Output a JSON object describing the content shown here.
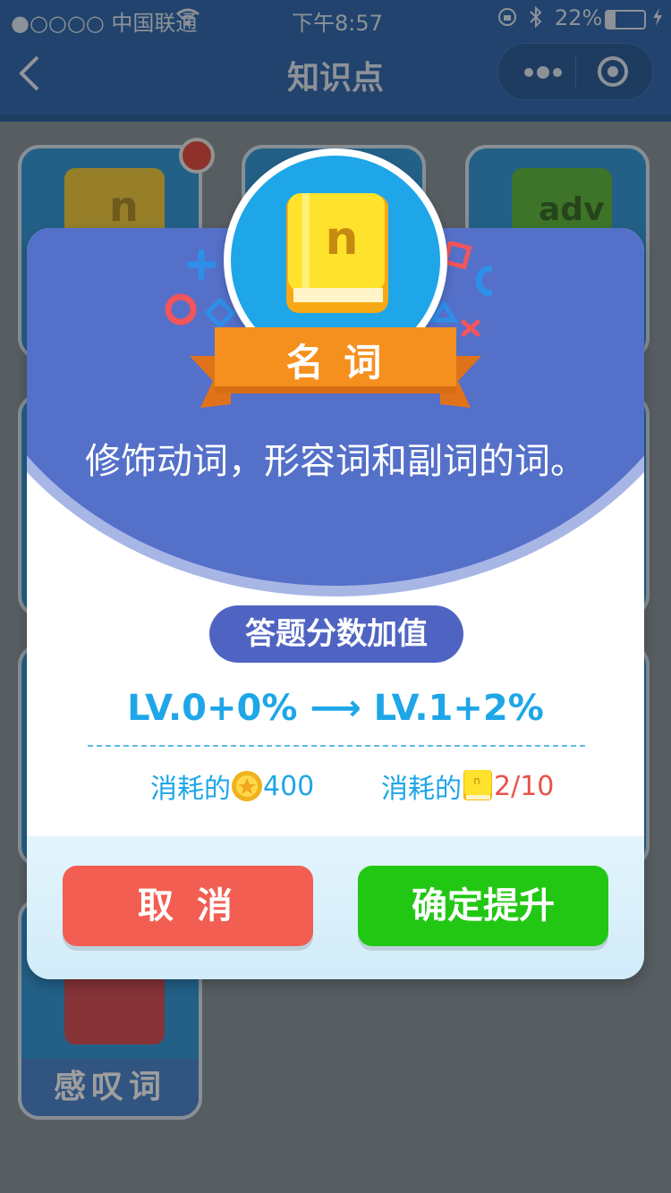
{
  "status": {
    "carrier": "●○○○○ 中国联通",
    "time": "下午8:57",
    "battery": "22%"
  },
  "nav": {
    "title": "知识点"
  },
  "cards": [
    {
      "letter": "n",
      "label": ""
    },
    {
      "letter": "",
      "label": ""
    },
    {
      "letter": "adv",
      "label": ""
    },
    {
      "letter": "",
      "label": "感叹词"
    }
  ],
  "modal": {
    "badge_letter": "n",
    "ribbon_title": "名 词",
    "description": "修饰动词，形容词和副词的词。",
    "section_pill": "答题分数加值",
    "level_from": "LV.0+0%",
    "level_arrow": "⟶",
    "level_to": "LV.1+2%",
    "cost_label_1": "消耗的",
    "cost_value_1": "400",
    "cost_label_2": "消耗的",
    "cost_value_2": "2/10",
    "cancel_label": "取 消",
    "confirm_label": "确定提升"
  },
  "colors": {
    "nav": "#1d5aa6",
    "modal_header": "#5470c9",
    "accent_blue": "#1ea6e8",
    "cancel": "#f25e52",
    "confirm": "#22c714",
    "red_text": "#e8524a"
  }
}
